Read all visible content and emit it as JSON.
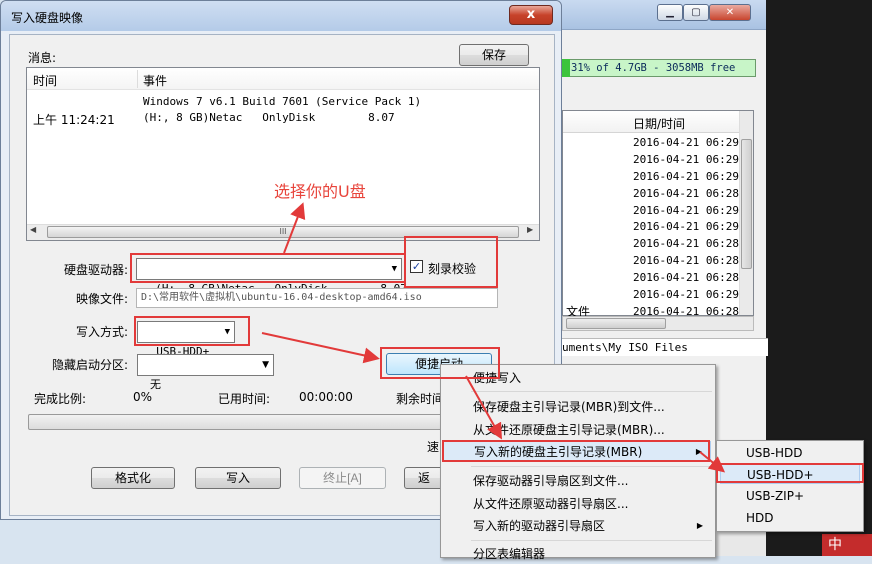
{
  "background_window": {
    "progress_text": "31% of 4.7GB - 3058MB free",
    "column_date_header": "日期/时间",
    "dates": [
      "2016-04-21 06:29",
      "2016-04-21 06:29",
      "2016-04-21 06:29",
      "2016-04-21 06:28",
      "2016-04-21 06:29",
      "2016-04-21 06:29",
      "2016-04-21 06:28",
      "2016-04-21 06:28",
      "2016-04-21 06:28",
      "2016-04-21 06:29",
      "2016-04-21 06:28"
    ],
    "file_label": "文件",
    "path": "uments\\My ISO Files",
    "ime": "中"
  },
  "dialog": {
    "title": "写入硬盘映像",
    "close_label": "x",
    "messages_label": "消息:",
    "save_button": "保存",
    "log": {
      "col_time": "时间",
      "col_event": "事件",
      "line1": "Windows 7 v6.1 Build 7601 (Service Pack 1)",
      "time2": "上午 11:24:21",
      "line2": "(H:, 8 GB)Netac   OnlyDisk        8.07",
      "scroll_grip": "III"
    },
    "drive_label": "硬盘驱动器:",
    "drive_value": "(H:, 8 GB)Netac   OnlyDisk        8.07",
    "verify_label": "刻录校验",
    "verify_checked": true,
    "image_label": "映像文件:",
    "image_value": "D:\\常用软件\\虚拟机\\ubuntu-16.04-desktop-amd64.iso",
    "write_mode_label": "写入方式:",
    "write_mode_value": "USB-HDD+",
    "hidden_part_label": "隐藏启动分区:",
    "hidden_part_value": "无",
    "quick_boot_button": "便捷启动",
    "ratio_label": "完成比例:",
    "ratio_value": "0%",
    "elapsed_label": "已用时间:",
    "elapsed_value": "00:00:00",
    "remaining_label": "剩余时间",
    "speed_label": "速",
    "progress": 0,
    "buttons": {
      "format": "格式化",
      "write": "写入",
      "stop": "终止[A]",
      "back": "返"
    }
  },
  "context_menu": {
    "items": [
      "便捷写入",
      "保存硬盘主引导记录(MBR)到文件...",
      "从文件还原硬盘主引导记录(MBR)...",
      "写入新的硬盘主引导记录(MBR)",
      "保存驱动器引导扇区到文件...",
      "从文件还原驱动器引导扇区...",
      "写入新的驱动器引导扇区",
      "分区表编辑器"
    ],
    "highlighted_index": 3
  },
  "submenu": {
    "items": [
      "USB-HDD",
      "USB-HDD+",
      "USB-ZIP+",
      "HDD"
    ],
    "selected": "USB-HDD+"
  },
  "annotation": {
    "text": "选择你的U盘",
    "color": "#e8453c"
  }
}
